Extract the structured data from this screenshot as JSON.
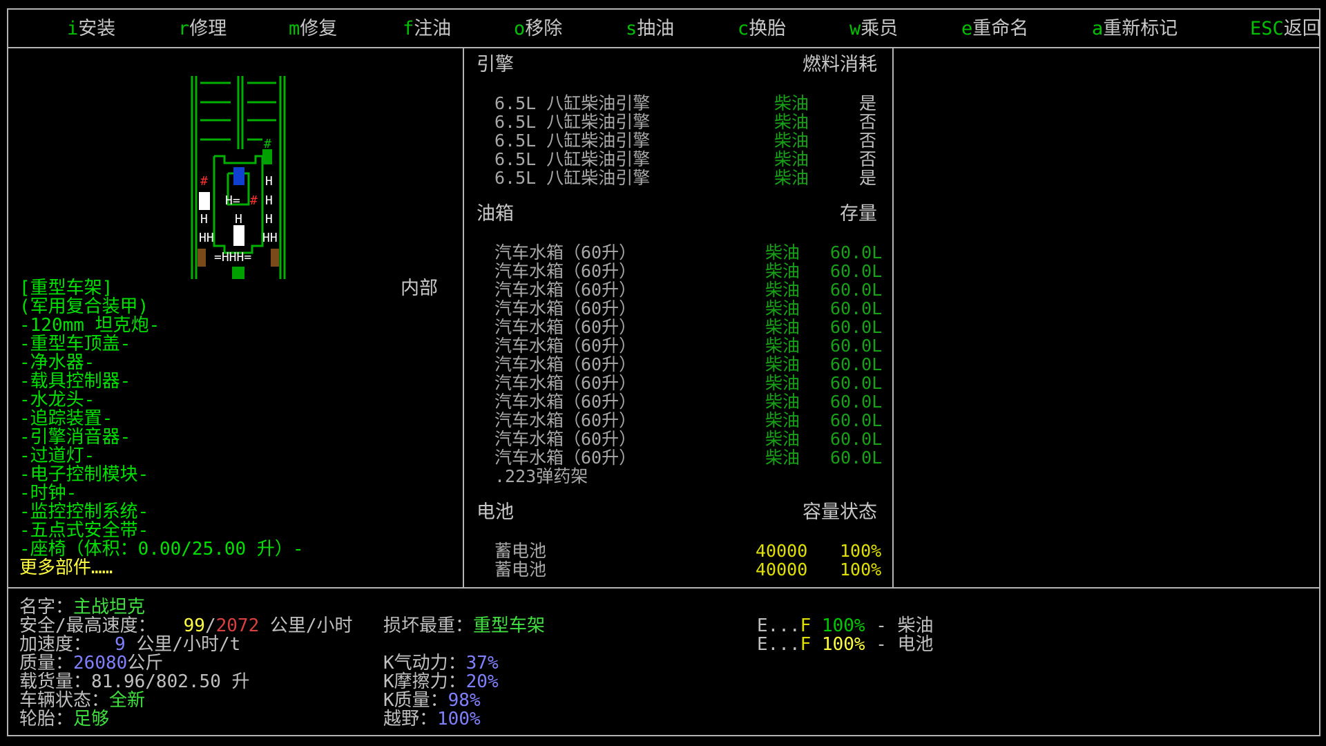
{
  "menu": [
    {
      "key": "i",
      "label": "安装"
    },
    {
      "key": "r",
      "label": "修理"
    },
    {
      "key": "m",
      "label": "修复"
    },
    {
      "key": "f",
      "label": "注油"
    },
    {
      "key": "o",
      "label": "移除"
    },
    {
      "key": "s",
      "label": "抽油"
    },
    {
      "key": "c",
      "label": "换胎"
    },
    {
      "key": "w",
      "label": "乘员"
    },
    {
      "key": "e",
      "label": "重命名"
    },
    {
      "key": "a",
      "label": "重新标记"
    },
    {
      "key": "ESC",
      "label": "返回"
    }
  ],
  "left": {
    "location_label": "内部",
    "parts": [
      "[重型车架]",
      "(军用复合装甲)",
      "-120mm 坦克炮-",
      "-重型车顶盖-",
      "-净水器-",
      "-载具控制器-",
      "-水龙头-",
      "-追踪装置-",
      "-引擎消音器-",
      "-过道灯-",
      "-电子控制模块-",
      "-时钟-",
      "-监控控制系统-",
      "-五点式安全带-",
      "-座椅（体积：0.00/25.00 升）-"
    ],
    "more_parts": "更多部件……"
  },
  "engines": {
    "title": "引擎",
    "col_header": "燃料消耗",
    "rows": [
      {
        "name": "6.5L 八缸柴油引擎",
        "fuel": "柴油",
        "active": "是"
      },
      {
        "name": "6.5L 八缸柴油引擎",
        "fuel": "柴油",
        "active": "否"
      },
      {
        "name": "6.5L 八缸柴油引擎",
        "fuel": "柴油",
        "active": "否"
      },
      {
        "name": "6.5L 八缸柴油引擎",
        "fuel": "柴油",
        "active": "否"
      },
      {
        "name": "6.5L 八缸柴油引擎",
        "fuel": "柴油",
        "active": "是"
      }
    ]
  },
  "tanks": {
    "title": "油箱",
    "col_header": "存量",
    "rows": [
      {
        "name": "汽车水箱（60升）",
        "fuel": "柴油",
        "amount": "60.0L"
      },
      {
        "name": "汽车水箱（60升）",
        "fuel": "柴油",
        "amount": "60.0L"
      },
      {
        "name": "汽车水箱（60升）",
        "fuel": "柴油",
        "amount": "60.0L"
      },
      {
        "name": "汽车水箱（60升）",
        "fuel": "柴油",
        "amount": "60.0L"
      },
      {
        "name": "汽车水箱（60升）",
        "fuel": "柴油",
        "amount": "60.0L"
      },
      {
        "name": "汽车水箱（60升）",
        "fuel": "柴油",
        "amount": "60.0L"
      },
      {
        "name": "汽车水箱（60升）",
        "fuel": "柴油",
        "amount": "60.0L"
      },
      {
        "name": "汽车水箱（60升）",
        "fuel": "柴油",
        "amount": "60.0L"
      },
      {
        "name": "汽车水箱（60升）",
        "fuel": "柴油",
        "amount": "60.0L"
      },
      {
        "name": "汽车水箱（60升）",
        "fuel": "柴油",
        "amount": "60.0L"
      },
      {
        "name": "汽车水箱（60升）",
        "fuel": "柴油",
        "amount": "60.0L"
      },
      {
        "name": "汽车水箱（60升）",
        "fuel": "柴油",
        "amount": "60.0L"
      }
    ],
    "extra": ".223弹药架"
  },
  "batteries": {
    "title": "电池",
    "col_header": "容量状态",
    "rows": [
      {
        "name": "蓄电池",
        "capacity": "40000",
        "percent": "100%"
      },
      {
        "name": "蓄电池",
        "capacity": "40000",
        "percent": "100%"
      }
    ]
  },
  "stats": {
    "name_label": "名字：",
    "name_value": "主战坦克",
    "speed_label": "安全/最高速度：",
    "speed_safe": "99",
    "speed_max": "2072",
    "speed_unit": "公里/小时",
    "accel_label": "加速度：",
    "accel_value": "9",
    "accel_unit": "公里/小时/t",
    "mass_label": "质量：",
    "mass_value": "26080",
    "mass_unit": "公斤",
    "cargo_label": "载货量：",
    "cargo_value": "81.96/802.50 升",
    "status_label": "车辆状态：",
    "status_value": "全新",
    "tires_label": "轮胎：",
    "tires_value": "足够",
    "damage_label": "损坏最重：",
    "damage_value": "重型车架",
    "aero_label": "K气动力：",
    "aero_value": "37%",
    "friction_label": "K摩擦力：",
    "friction_value": "20%",
    "kmass_label": "K质量：",
    "kmass_value": "98%",
    "offroad_label": "越野：",
    "offroad_value": "100%"
  },
  "gauges": [
    {
      "e": "E...",
      "f": "F",
      "percent": "100%",
      "sep": " - ",
      "name": "柴油"
    },
    {
      "e": "E...",
      "f": "F",
      "percent": "100%",
      "sep": " - ",
      "name": "电池"
    }
  ],
  "colors": {
    "border": "#b4b4b4",
    "key": "#00c000",
    "green": "#00c800",
    "yellow": "#ffff40",
    "blue": "#8080ff"
  }
}
